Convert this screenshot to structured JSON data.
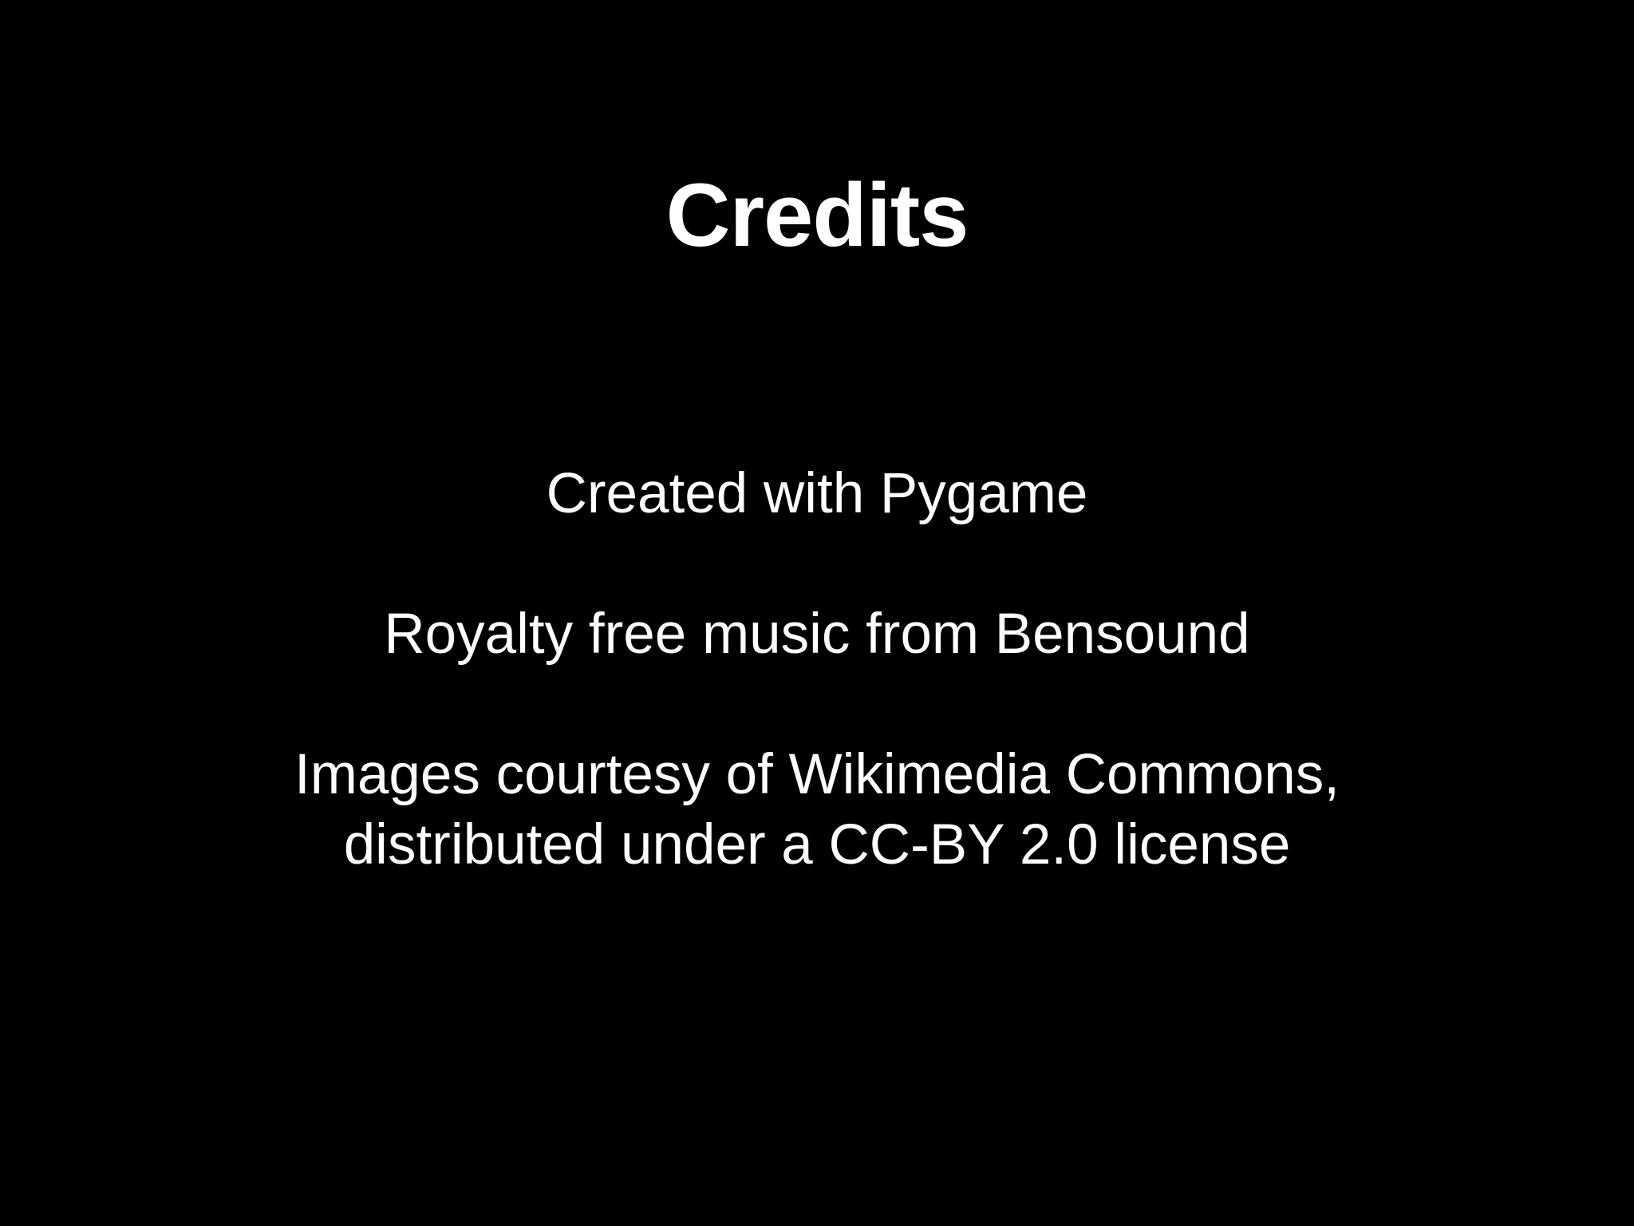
{
  "screen": {
    "title": "Credits",
    "lines": [
      "Created with Pygame",
      "Royalty free music from Bensound",
      "Images courtesy of Wikimedia Commons,",
      "distributed under a CC-BY 2.0 license"
    ]
  },
  "colors": {
    "background": "#000000",
    "text": "#ffffff"
  }
}
